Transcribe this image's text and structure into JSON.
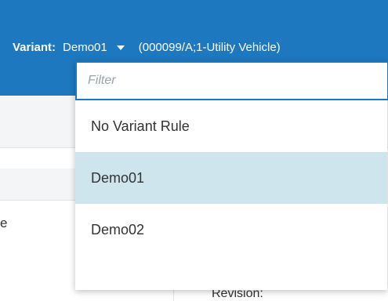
{
  "header": {
    "variant_label": "Variant:",
    "variant_value": "Demo01",
    "variant_context": "(000099/A;1-Utility Vehicle)"
  },
  "dropdown": {
    "filter_placeholder": "Filter",
    "filter_value": "",
    "options": [
      {
        "label": "No Variant Rule",
        "selected": false
      },
      {
        "label": "Demo01",
        "selected": true
      },
      {
        "label": "Demo02",
        "selected": false
      }
    ]
  },
  "background": {
    "fragment_text": "e",
    "revision_label": "Revision:"
  },
  "colors": {
    "header_bg": "#1d78bf",
    "selected_option_bg": "#cfe5ee",
    "filter_border": "#1d78bf"
  }
}
